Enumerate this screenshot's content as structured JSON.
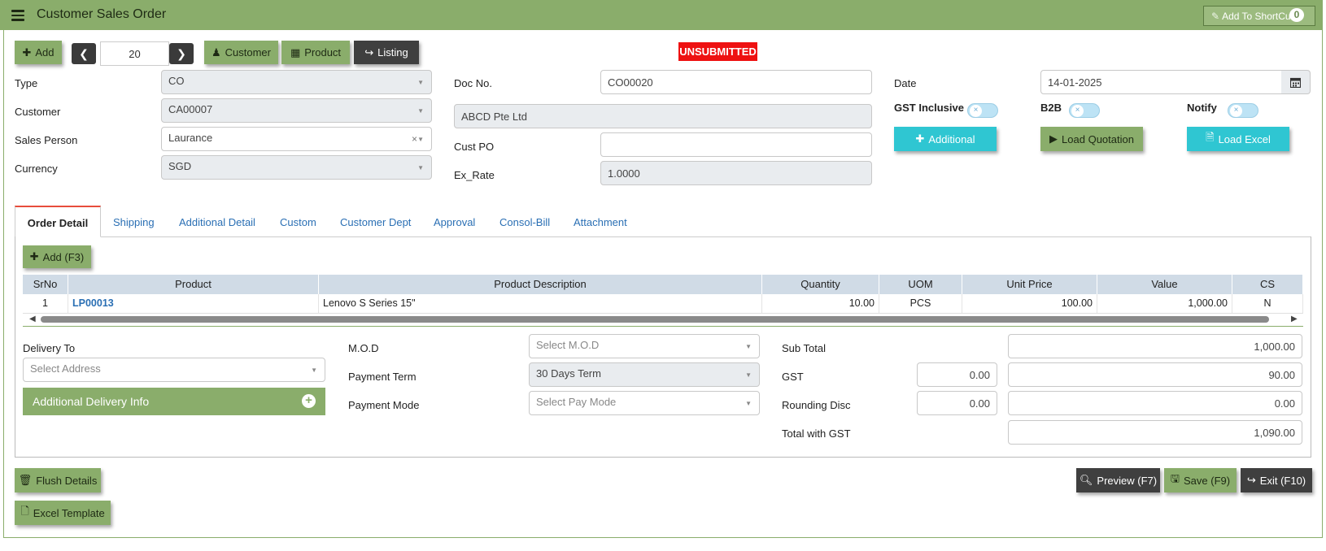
{
  "header": {
    "title": "Customer Sales Order",
    "shortcut_label": "Add To ShortCut",
    "shortcut_count": "0"
  },
  "toolbar": {
    "add_label": "Add",
    "record_number": "20",
    "customer_label": "Customer",
    "product_label": "Product",
    "listing_label": "Listing",
    "status": "UNSUBMITTED"
  },
  "form": {
    "type_label": "Type",
    "type_value": "CO",
    "customer_label": "Customer",
    "customer_value": "CA00007",
    "sales_person_label": "Sales Person",
    "sales_person_value": "Laurance",
    "currency_label": "Currency",
    "currency_value": "SGD",
    "doc_no_label": "Doc No.",
    "doc_no_value": "CO00020",
    "customer_name": "ABCD Pte Ltd",
    "cust_po_label": "Cust PO",
    "cust_po_value": "",
    "ex_rate_label": "Ex_Rate",
    "ex_rate_value": "1.0000",
    "date_label": "Date",
    "date_value": "14-01-2025",
    "gst_inclusive_label": "GST Inclusive",
    "b2b_label": "B2B",
    "notify_label": "Notify",
    "additional_label": "Additional",
    "load_quotation_label": "Load Quotation",
    "load_excel_label": "Load Excel"
  },
  "tabs": [
    "Order Detail",
    "Shipping",
    "Additional Detail",
    "Custom",
    "Customer Dept",
    "Approval",
    "Consol-Bill",
    "Attachment"
  ],
  "order_detail": {
    "add_label": "Add (F3)",
    "columns": [
      "SrNo",
      "Product",
      "Product Description",
      "Quantity",
      "UOM",
      "Unit Price",
      "Value",
      "CS"
    ],
    "rows": [
      {
        "srno": "1",
        "product": "LP00013",
        "description": "Lenovo S Series 15\"",
        "quantity": "10.00",
        "uom": "PCS",
        "unit_price": "100.00",
        "value": "1,000.00",
        "cs": "N"
      }
    ]
  },
  "delivery": {
    "label": "Delivery To",
    "address_placeholder": "Select Address",
    "additional_info_label": "Additional Delivery Info"
  },
  "payment": {
    "mod_label": "M.O.D",
    "mod_placeholder": "Select M.O.D",
    "term_label": "Payment Term",
    "term_value": "30 Days Term",
    "mode_label": "Payment Mode",
    "mode_placeholder": "Select Pay Mode"
  },
  "totals": {
    "sub_total_label": "Sub Total",
    "sub_total": "1,000.00",
    "gst_label": "GST",
    "gst_rate": "0.00",
    "gst_amount": "90.00",
    "rounding_label": "Rounding Disc",
    "rounding_rate": "0.00",
    "rounding_amount": "0.00",
    "total_label": "Total with GST",
    "total": "1,090.00"
  },
  "footer": {
    "flush_label": "Flush Details",
    "excel_template_label": "Excel Template",
    "preview_label": "Preview (F7)",
    "save_label": "Save (F9)",
    "exit_label": "Exit (F10)"
  },
  "colors": {
    "accent_green": "#8aad6b",
    "teal": "#2fc6d2",
    "dark": "#3f3f3f",
    "status_red": "#ee1111",
    "link_blue": "#2a6fb4"
  }
}
